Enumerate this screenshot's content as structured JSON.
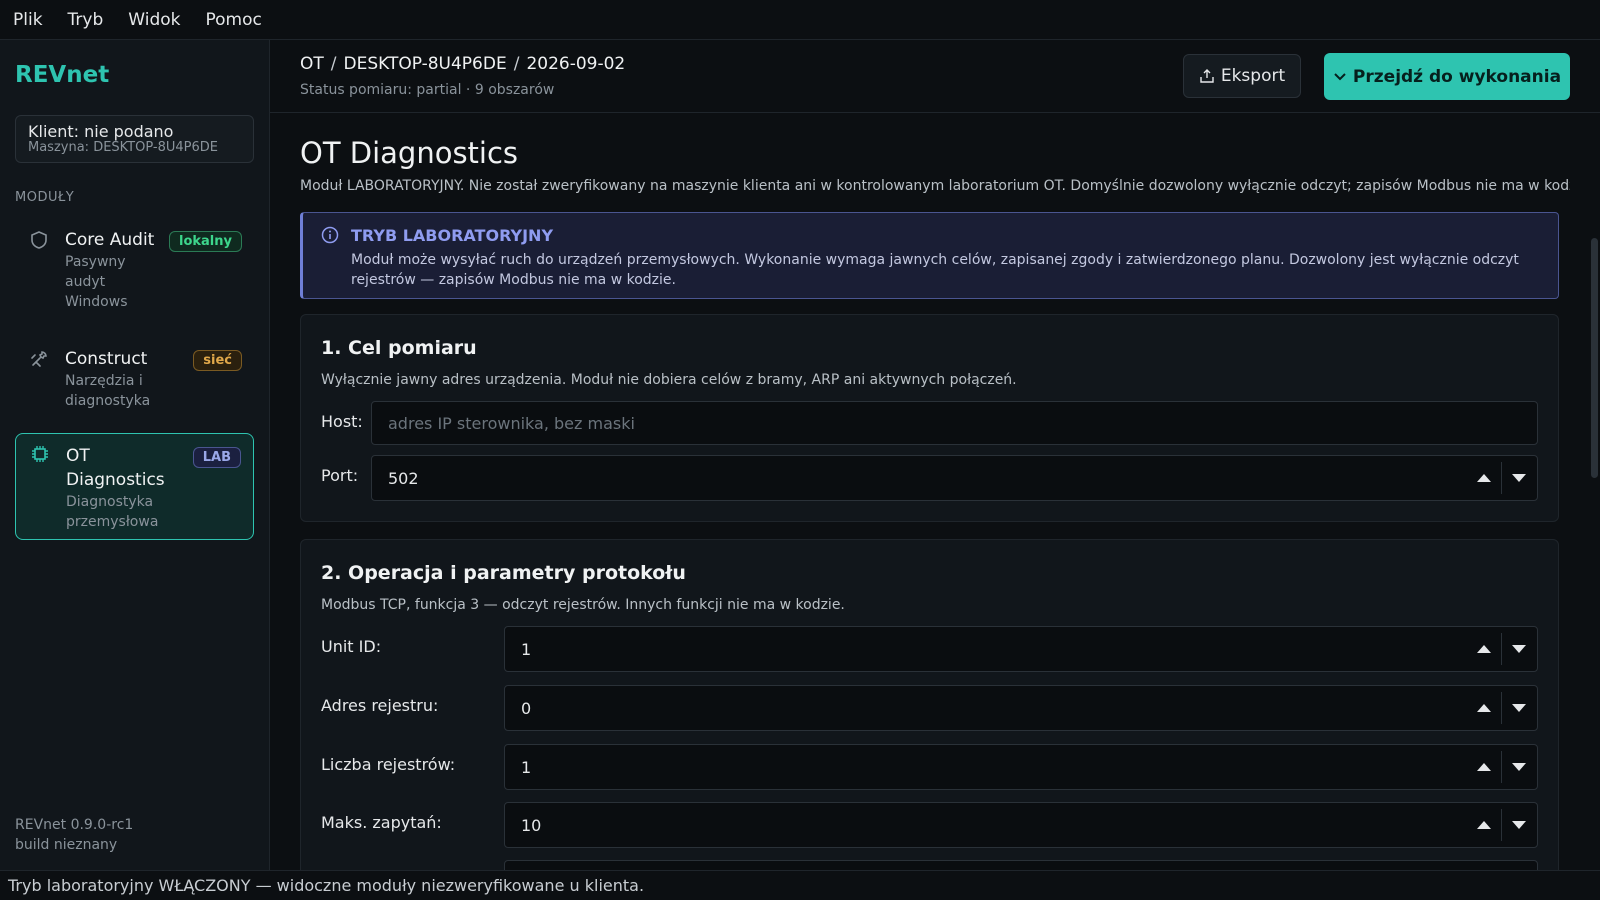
{
  "menubar": {
    "items": [
      {
        "label": "Plik"
      },
      {
        "label": "Tryb"
      },
      {
        "label": "Widok"
      },
      {
        "label": "Pomoc"
      }
    ]
  },
  "sidebar": {
    "brand": "REVnet",
    "client": {
      "name": "Klient: nie podano",
      "machine": "Maszyna: DESKTOP-8U4P6DE"
    },
    "section_label": "MODUŁY",
    "modules": [
      {
        "title": "Core Audit",
        "desc": "Pasywny audyt Windows",
        "badge": "lokalny",
        "icon": "shield-icon"
      },
      {
        "title": "Construct",
        "desc": "Narzędzia i diagnostyka",
        "badge": "sieć",
        "icon": "wrench-icon"
      },
      {
        "title": "OT Diagnostics",
        "desc": "Diagnostyka przemysłowa",
        "badge": "LAB",
        "icon": "chip-icon"
      }
    ],
    "footer": {
      "version": "REVnet 0.9.0-rc1",
      "build": "build nieznany"
    }
  },
  "header": {
    "crumbs": [
      "OT",
      "DESKTOP-8U4P6DE",
      "2026-09-02"
    ],
    "crumb_sep": "/",
    "status": "Status pomiaru: partial · 9 obszarów",
    "export_label": "Eksport",
    "primary_label": "Przejdź do wykonania"
  },
  "page": {
    "title": "OT Diagnostics",
    "desc": "Moduł LABORATORYJNY. Nie został zweryfikowany na maszynie klienta ani w kontrolowanym laboratorium OT. Domyślnie dozwolony wyłącznie odczyt; zapisów Modbus nie ma w kodzie.",
    "alert": {
      "title": "TRYB LABORATORYJNY",
      "text": "Moduł może wysyłać ruch do urządzeń przemysłowych. Wykonanie wymaga jawnych celów, zapisanej zgody i zatwierdzonego planu. Dozwolony jest wyłącznie odczyt rejestrów — zapisów Modbus nie ma w kodzie."
    },
    "target_card": {
      "title": "1. Cel pomiaru",
      "sub": "Wyłącznie jawny adres urządzenia. Moduł nie dobiera celów z bramy, ARP ani aktywnych połączeń.",
      "host_label": "Host:",
      "host_placeholder": "adres IP sterownika, bez maski",
      "port_label": "Port:",
      "port_value": "502"
    },
    "protocol_card": {
      "title": "2. Operacja i parametry protokołu",
      "sub": "Modbus TCP, funkcja 3 — odczyt rejestrów. Innych funkcji nie ma w kodzie.",
      "fields": [
        {
          "label": "Unit ID:",
          "value": "1"
        },
        {
          "label": "Adres rejestru:",
          "value": "0"
        },
        {
          "label": "Liczba rejestrów:",
          "value": "1"
        },
        {
          "label": "Maks. zapytań:",
          "value": "10"
        }
      ]
    }
  },
  "statusbar": {
    "text": "Tryb laboratoryjny WŁĄCZONY — widoczne moduły niezweryfikowane u klienta."
  },
  "colors": {
    "accent": "#2ec4b0",
    "lab": "#8f9cf0",
    "local": "#3dd68c",
    "net": "#e0a84a"
  }
}
